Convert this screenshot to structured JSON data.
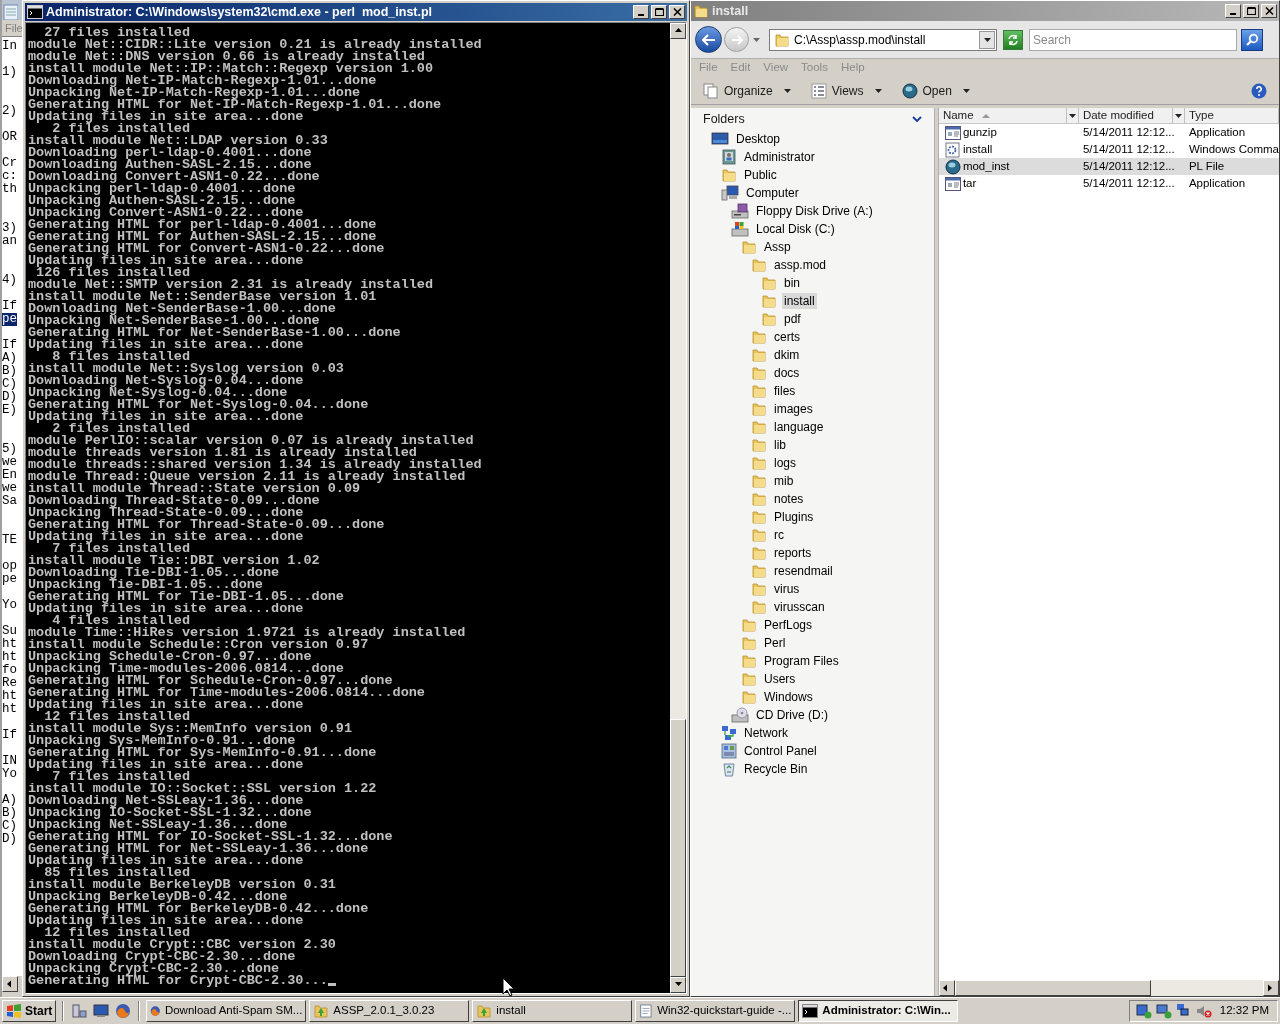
{
  "background_window": {
    "menu": [
      "File"
    ],
    "lines": [
      {
        "kind": "text",
        "text": "In",
        "selected": false
      },
      {
        "kind": "blank"
      },
      {
        "kind": "text",
        "text": "1)",
        "selected": false
      },
      {
        "kind": "blank"
      },
      {
        "kind": "blank"
      },
      {
        "kind": "text",
        "text": "2)",
        "selected": false
      },
      {
        "kind": "blank"
      },
      {
        "kind": "text",
        "text": "OR",
        "selected": false
      },
      {
        "kind": "blank"
      },
      {
        "kind": "text",
        "text": "Cr",
        "selected": false
      },
      {
        "kind": "text",
        "text": "c:",
        "selected": false
      },
      {
        "kind": "text",
        "text": "th",
        "selected": false
      },
      {
        "kind": "blank"
      },
      {
        "kind": "blank"
      },
      {
        "kind": "text",
        "text": "3)",
        "selected": false
      },
      {
        "kind": "text",
        "text": "an",
        "selected": false
      },
      {
        "kind": "blank"
      },
      {
        "kind": "blank"
      },
      {
        "kind": "text",
        "text": "4)",
        "selected": false
      },
      {
        "kind": "blank"
      },
      {
        "kind": "text",
        "text": "If",
        "selected": false
      },
      {
        "kind": "text",
        "text": "pe",
        "selected": true
      },
      {
        "kind": "blank"
      },
      {
        "kind": "text",
        "text": "If",
        "selected": false
      },
      {
        "kind": "text",
        "text": "A)",
        "selected": false
      },
      {
        "kind": "text",
        "text": "B)",
        "selected": false
      },
      {
        "kind": "text",
        "text": "C)",
        "selected": false
      },
      {
        "kind": "text",
        "text": "D)",
        "selected": false
      },
      {
        "kind": "text",
        "text": "E)",
        "selected": false
      },
      {
        "kind": "blank"
      },
      {
        "kind": "blank"
      },
      {
        "kind": "text",
        "text": "5)",
        "selected": false
      },
      {
        "kind": "text",
        "text": "we",
        "selected": false
      },
      {
        "kind": "text",
        "text": "En",
        "selected": false
      },
      {
        "kind": "text",
        "text": "we",
        "selected": false
      },
      {
        "kind": "text",
        "text": "Sa",
        "selected": false
      },
      {
        "kind": "blank"
      },
      {
        "kind": "blank"
      },
      {
        "kind": "text",
        "text": "TE",
        "selected": false
      },
      {
        "kind": "blank"
      },
      {
        "kind": "text",
        "text": "op",
        "selected": false
      },
      {
        "kind": "text",
        "text": "pe",
        "selected": false
      },
      {
        "kind": "blank"
      },
      {
        "kind": "text",
        "text": "Yo",
        "selected": false
      },
      {
        "kind": "blank"
      },
      {
        "kind": "text",
        "text": "Su",
        "selected": false
      },
      {
        "kind": "text",
        "text": "ht",
        "selected": false
      },
      {
        "kind": "text",
        "text": "ht",
        "selected": false
      },
      {
        "kind": "text",
        "text": "fo",
        "selected": false
      },
      {
        "kind": "text",
        "text": "Re",
        "selected": false
      },
      {
        "kind": "text",
        "text": "ht",
        "selected": false
      },
      {
        "kind": "text",
        "text": "ht",
        "selected": false
      },
      {
        "kind": "blank"
      },
      {
        "kind": "text",
        "text": "If",
        "selected": false
      },
      {
        "kind": "blank"
      },
      {
        "kind": "text",
        "text": "IN",
        "selected": false
      },
      {
        "kind": "text",
        "text": "Yo",
        "selected": false
      },
      {
        "kind": "blank"
      },
      {
        "kind": "text",
        "text": "A)",
        "selected": false
      },
      {
        "kind": "text",
        "text": "B)",
        "selected": false
      },
      {
        "kind": "text",
        "text": "C)",
        "selected": false
      },
      {
        "kind": "text",
        "text": "D)",
        "selected": false
      }
    ]
  },
  "console": {
    "title": "Administrator: C:\\Windows\\system32\\cmd.exe - perl  mod_inst.pl",
    "lines": [
      "  27 files installed",
      "module Net::CIDR::Lite version 0.21 is already installed",
      "module Net::DNS version 0.66 is already installed",
      "install module Net::IP::Match::Regexp version 1.00",
      "Downloading Net-IP-Match-Regexp-1.01...done",
      "Unpacking Net-IP-Match-Regexp-1.01...done",
      "Generating HTML for Net-IP-Match-Regexp-1.01...done",
      "Updating files in site area...done",
      "   2 files installed",
      "install module Net::LDAP version 0.33",
      "Downloading perl-ldap-0.4001...done",
      "Downloading Authen-SASL-2.15...done",
      "Downloading Convert-ASN1-0.22...done",
      "Unpacking perl-ldap-0.4001...done",
      "Unpacking Authen-SASL-2.15...done",
      "Unpacking Convert-ASN1-0.22...done",
      "Generating HTML for perl-ldap-0.4001...done",
      "Generating HTML for Authen-SASL-2.15...done",
      "Generating HTML for Convert-ASN1-0.22...done",
      "Updating files in site area...done",
      " 126 files installed",
      "module Net::SMTP version 2.31 is already installed",
      "install module Net::SenderBase version 1.01",
      "Downloading Net-SenderBase-1.00...done",
      "Unpacking Net-SenderBase-1.00...done",
      "Generating HTML for Net-SenderBase-1.00...done",
      "Updating files in site area...done",
      "   8 files installed",
      "install module Net::Syslog version 0.03",
      "Downloading Net-Syslog-0.04...done",
      "Unpacking Net-Syslog-0.04...done",
      "Generating HTML for Net-Syslog-0.04...done",
      "Updating files in site area...done",
      "   2 files installed",
      "module PerlIO::scalar version 0.07 is already installed",
      "module threads version 1.81 is already installed",
      "module threads::shared version 1.34 is already installed",
      "module Thread::Queue version 2.11 is already installed",
      "install module Thread::State version 0.09",
      "Downloading Thread-State-0.09...done",
      "Unpacking Thread-State-0.09...done",
      "Generating HTML for Thread-State-0.09...done",
      "Updating files in site area...done",
      "   7 files installed",
      "install module Tie::DBI version 1.02",
      "Downloading Tie-DBI-1.05...done",
      "Unpacking Tie-DBI-1.05...done",
      "Generating HTML for Tie-DBI-1.05...done",
      "Updating files in site area...done",
      "   4 files installed",
      "module Time::HiRes version 1.9721 is already installed",
      "install module Schedule::Cron version 0.97",
      "Unpacking Schedule-Cron-0.97...done",
      "Unpacking Time-modules-2006.0814...done",
      "Generating HTML for Schedule-Cron-0.97...done",
      "Generating HTML for Time-modules-2006.0814...done",
      "Updating files in site area...done",
      "  12 files installed",
      "install module Sys::MemInfo version 0.91",
      "Unpacking Sys-MemInfo-0.91...done",
      "Generating HTML for Sys-MemInfo-0.91...done",
      "Updating files in site area...done",
      "   7 files installed",
      "install module IO::Socket::SSL version 1.22",
      "Downloading Net-SSLeay-1.36...done",
      "Unpacking IO-Socket-SSL-1.32...done",
      "Unpacking Net-SSLeay-1.36...done",
      "Generating HTML for IO-Socket-SSL-1.32...done",
      "Generating HTML for Net-SSLeay-1.36...done",
      "Updating files in site area...done",
      "  85 files installed",
      "install module BerkeleyDB version 0.31",
      "Unpacking BerkeleyDB-0.42...done",
      "Generating HTML for BerkeleyDB-0.42...done",
      "Updating files in site area...done",
      "  12 files installed",
      "install module Crypt::CBC version 2.30",
      "Downloading Crypt-CBC-2.30...done",
      "Unpacking Crypt-CBC-2.30...done",
      "Generating HTML for Crypt-CBC-2.30..."
    ]
  },
  "explorer": {
    "title": "install",
    "address": "C:\\Assp\\assp.mod\\install",
    "search": {
      "placeholder": "Search"
    },
    "menu": [
      "File",
      "Edit",
      "View",
      "Tools",
      "Help"
    ],
    "toolbar": [
      {
        "label": "Organize",
        "kind": "organize"
      },
      {
        "label": "Views",
        "kind": "views"
      },
      {
        "label": "Open",
        "kind": "open"
      }
    ],
    "folders_pane": {
      "title": "Folders",
      "tree": [
        {
          "label": "Desktop",
          "kind": "desktop",
          "selected": false,
          "children": [
            {
              "label": "Administrator",
              "kind": "user",
              "selected": false
            },
            {
              "label": "Public",
              "kind": "folder",
              "selected": false
            },
            {
              "label": "Computer",
              "kind": "computer",
              "selected": false,
              "children": [
                {
                  "label": "Floppy Disk Drive (A:)",
                  "kind": "floppy",
                  "selected": false
                },
                {
                  "label": "Local Disk (C:)",
                  "kind": "disk",
                  "selected": false,
                  "children": [
                    {
                      "label": "Assp",
                      "kind": "folder",
                      "selected": false,
                      "children": [
                        {
                          "label": "assp.mod",
                          "kind": "folder",
                          "selected": false,
                          "children": [
                            {
                              "label": "bin",
                              "kind": "folder",
                              "selected": false
                            },
                            {
                              "label": "install",
                              "kind": "folder",
                              "selected": true
                            },
                            {
                              "label": "pdf",
                              "kind": "folder",
                              "selected": false
                            }
                          ]
                        },
                        {
                          "label": "certs",
                          "kind": "folder",
                          "selected": false
                        },
                        {
                          "label": "dkim",
                          "kind": "folder",
                          "selected": false
                        },
                        {
                          "label": "docs",
                          "kind": "folder",
                          "selected": false
                        },
                        {
                          "label": "files",
                          "kind": "folder",
                          "selected": false
                        },
                        {
                          "label": "images",
                          "kind": "folder",
                          "selected": false
                        },
                        {
                          "label": "language",
                          "kind": "folder",
                          "selected": false
                        },
                        {
                          "label": "lib",
                          "kind": "folder",
                          "selected": false
                        },
                        {
                          "label": "logs",
                          "kind": "folder",
                          "selected": false
                        },
                        {
                          "label": "mib",
                          "kind": "folder",
                          "selected": false
                        },
                        {
                          "label": "notes",
                          "kind": "folder",
                          "selected": false
                        },
                        {
                          "label": "Plugins",
                          "kind": "folder",
                          "selected": false
                        },
                        {
                          "label": "rc",
                          "kind": "folder",
                          "selected": false
                        },
                        {
                          "label": "reports",
                          "kind": "folder",
                          "selected": false
                        },
                        {
                          "label": "resendmail",
                          "kind": "folder",
                          "selected": false
                        },
                        {
                          "label": "virus",
                          "kind": "folder",
                          "selected": false
                        },
                        {
                          "label": "virusscan",
                          "kind": "folder",
                          "selected": false
                        }
                      ]
                    },
                    {
                      "label": "PerfLogs",
                      "kind": "folder",
                      "selected": false
                    },
                    {
                      "label": "Perl",
                      "kind": "folder",
                      "selected": false
                    },
                    {
                      "label": "Program Files",
                      "kind": "folder",
                      "selected": false
                    },
                    {
                      "label": "Users",
                      "kind": "folder",
                      "selected": false
                    },
                    {
                      "label": "Windows",
                      "kind": "folder",
                      "selected": false
                    }
                  ]
                },
                {
                  "label": "CD Drive (D:)",
                  "kind": "cd",
                  "selected": false
                }
              ]
            },
            {
              "label": "Network",
              "kind": "network",
              "selected": false
            },
            {
              "label": "Control Panel",
              "kind": "control-panel",
              "selected": false
            },
            {
              "label": "Recycle Bin",
              "kind": "recycle-bin",
              "selected": false
            }
          ]
        }
      ]
    },
    "file_list": {
      "columns": [
        {
          "label": "Name",
          "sorted_ascending": true
        },
        {
          "label": "Date modified"
        },
        {
          "label": "Type"
        }
      ],
      "rows": [
        {
          "name": "gunzip",
          "kind": "application",
          "date": "5/14/2011 12:12...",
          "type": "Application",
          "selected": false
        },
        {
          "name": "install",
          "kind": "script",
          "date": "5/14/2011 12:12...",
          "type": "Windows Comma",
          "selected": false
        },
        {
          "name": "mod_inst",
          "kind": "perl",
          "date": "5/14/2011 12:12...",
          "type": "PL File",
          "selected": true
        },
        {
          "name": "tar",
          "kind": "application",
          "date": "5/14/2011 12:12...",
          "type": "Application",
          "selected": false
        }
      ]
    }
  },
  "taskbar": {
    "start": "Start",
    "tasks": [
      {
        "label": "Download Anti-Spam SM...",
        "kind": "browser",
        "selected": false
      },
      {
        "label": "ASSP_2.0.1_3.0.23",
        "kind": "folder",
        "selected": false
      },
      {
        "label": "install",
        "kind": "folder",
        "selected": false
      },
      {
        "label": "Win32-quickstart-guide -...",
        "kind": "document",
        "selected": false
      },
      {
        "label": "Administrator: C:\\Win...",
        "kind": "console",
        "selected": true
      }
    ],
    "clock": "12:32 PM"
  }
}
